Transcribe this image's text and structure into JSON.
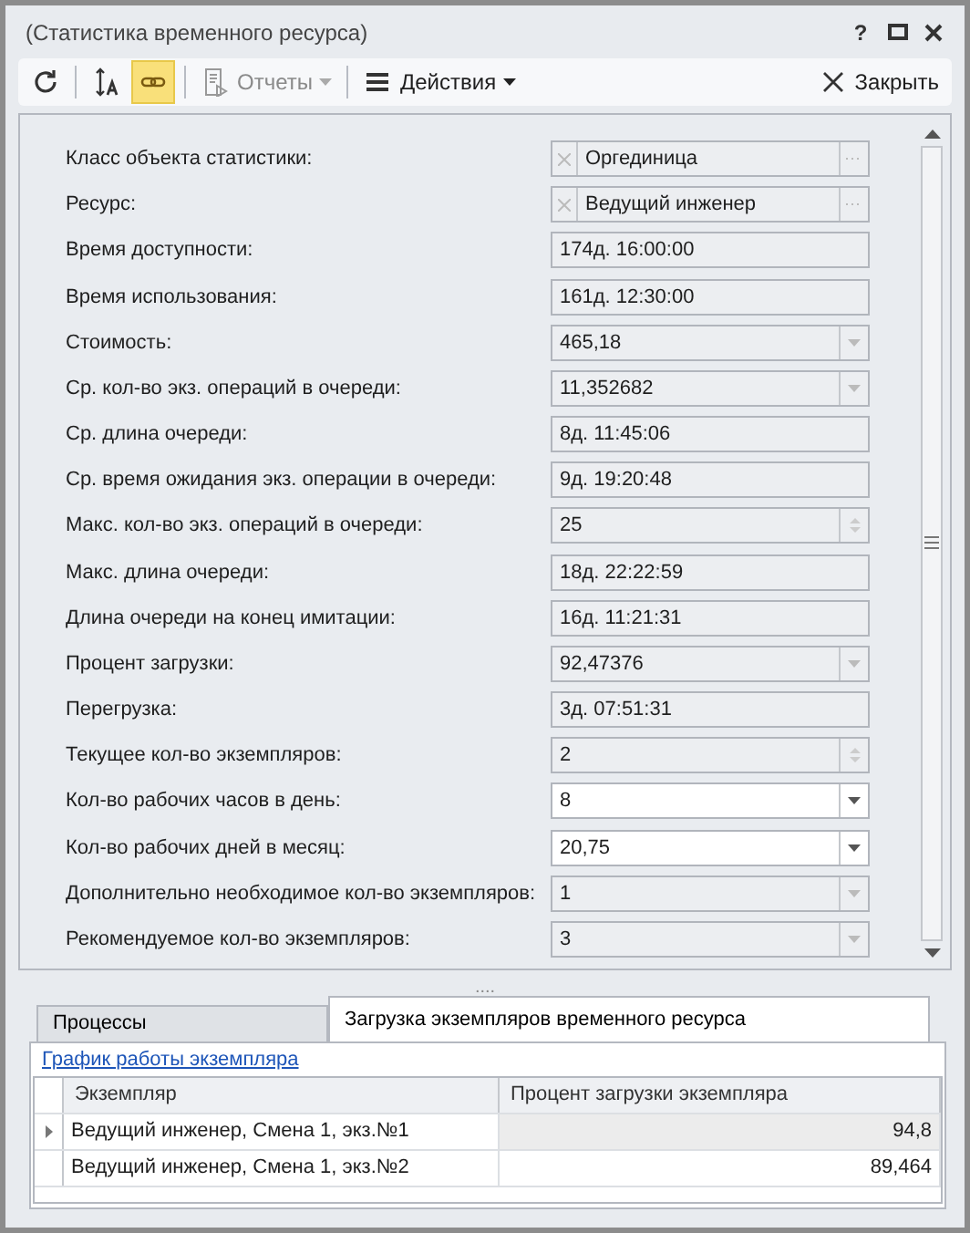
{
  "window": {
    "title": "(Статистика временного ресурса)",
    "controls": [
      "?"
    ]
  },
  "toolbar": [
    {
      "kind": "refresh",
      "selected": false,
      "disabled": false
    },
    {
      "kind": "sort",
      "selected": false,
      "disabled": false
    },
    {
      "kind": "link",
      "selected": true,
      "disabled": false
    },
    {
      "kind": "reports",
      "label": "Отчеты",
      "selected": false,
      "disabled": true
    },
    {
      "kind": "actions",
      "label": "Действия",
      "selected": false,
      "disabled": false
    },
    {
      "kind": "close",
      "label": "Закрыть",
      "selected": false,
      "disabled": false
    }
  ],
  "fields": [
    {
      "label": "Класс объекта статистики:",
      "value": "Оргединица",
      "kind": "lookup",
      "editable": false
    },
    {
      "label": "Ресурс:",
      "value": "Ведущий инженер",
      "kind": "lookup",
      "editable": false
    },
    {
      "label": "Время доступности:",
      "value": "174д. 16:00:00",
      "kind": "text",
      "editable": false
    },
    {
      "label": "Время использования:",
      "value": "161д. 12:30:00",
      "kind": "text",
      "editable": false
    },
    {
      "label": "Стоимость:",
      "value": "465,18",
      "kind": "dropdown",
      "editable": false
    },
    {
      "label": "Ср. кол-во экз. операций в очереди:",
      "value": "11,352682",
      "kind": "dropdown",
      "editable": false
    },
    {
      "label": "Ср. длина очереди:",
      "value": "8д. 11:45:06",
      "kind": "text",
      "editable": false
    },
    {
      "label": "Ср. время ожидания экз. операции в очереди:",
      "value": "9д. 19:20:48",
      "kind": "text",
      "editable": false
    },
    {
      "label": "Макс. кол-во экз. операций в очереди:",
      "value": "25",
      "kind": "spin",
      "editable": false
    },
    {
      "label": "Макс. длина очереди:",
      "value": "18д. 22:22:59",
      "kind": "text",
      "editable": false
    },
    {
      "label": "Длина очереди на конец имитации:",
      "value": "16д. 11:21:31",
      "kind": "text",
      "editable": false
    },
    {
      "label": "Процент загрузки:",
      "value": "92,47376",
      "kind": "dropdown",
      "editable": false
    },
    {
      "label": "Перегрузка:",
      "value": "3д. 07:51:31",
      "kind": "text",
      "editable": false
    },
    {
      "label": "Текущее кол-во экземпляров:",
      "value": "2",
      "kind": "spin",
      "editable": false
    },
    {
      "label": "Кол-во рабочих часов в день:",
      "value": "8",
      "kind": "dropdown",
      "editable": true
    },
    {
      "label": "Кол-во рабочих дней в месяц:",
      "value": "20,75",
      "kind": "dropdown",
      "editable": true
    },
    {
      "label": "Дополнительно необходимое кол-во экземпляров:",
      "value": "1",
      "kind": "dropdown",
      "editable": false
    },
    {
      "label": "Рекомендуемое кол-во экземпляров:",
      "value": "3",
      "kind": "dropdown",
      "editable": false
    }
  ],
  "splitter": "....",
  "tabs": [
    {
      "label": "Процессы",
      "selected": false
    },
    {
      "label": "Загрузка экземпляров временного ресурса",
      "selected": true
    }
  ],
  "link": "График работы экземпляра",
  "table": {
    "columns": [
      "Экземпляр",
      "Процент загрузки экземпляра"
    ],
    "rows": [
      {
        "cells": [
          "Ведущий инженер, Смена 1, экз.№1",
          "94,8"
        ],
        "selected": true
      },
      {
        "cells": [
          "Ведущий инженер, Смена 1, экз.№2",
          "89,464"
        ],
        "selected": false
      }
    ]
  }
}
